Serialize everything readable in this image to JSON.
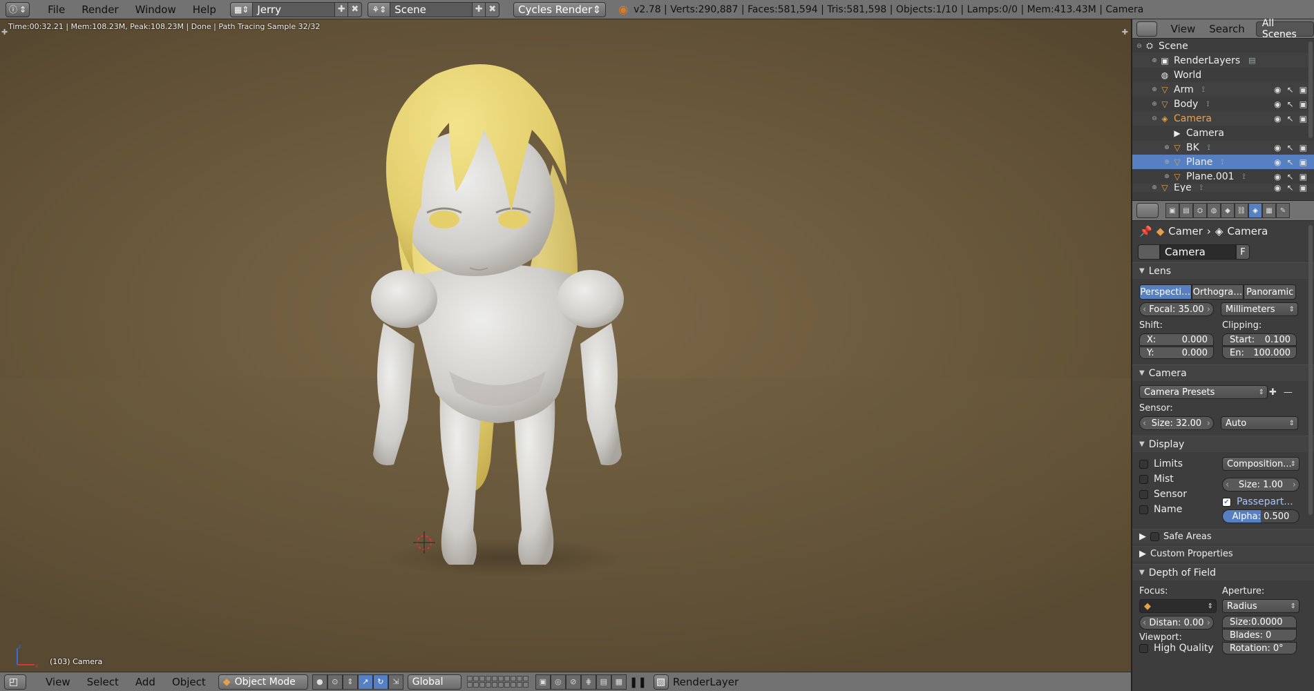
{
  "topbar": {
    "menus": [
      "File",
      "Render",
      "Window",
      "Help"
    ],
    "screen_layout": "Jerry",
    "scene": "Scene",
    "render_engine": "Cycles Render",
    "stats": "v2.78 | Verts:290,887 | Faces:581,594 | Tris:581,598 | Objects:1/10 | Lamps:0/0 | Mem:413.43M | Camera"
  },
  "viewport": {
    "render_stamp": "Time:00:32.21 | Mem:108.23M, Peak:108.23M | Done | Path Tracing Sample 32/32",
    "view_name": "(103) Camera",
    "colors": {
      "hair": "#e9d77a",
      "body": "#d7d5d1",
      "eyes": "#e5cf6a"
    }
  },
  "bottombar": {
    "menus": [
      "View",
      "Select",
      "Add",
      "Object"
    ],
    "mode": "Object Mode",
    "orientation": "Global",
    "render_layer": "RenderLayer"
  },
  "outliner": {
    "header_menus": [
      "View",
      "Search"
    ],
    "filter": "All Scenes",
    "items": [
      {
        "label": "Scene",
        "icon": "scene-icon",
        "indent": 0
      },
      {
        "label": "RenderLayers",
        "icon": "renderlayers-icon",
        "indent": 1
      },
      {
        "label": "World",
        "icon": "world-icon",
        "indent": 1
      },
      {
        "label": "Arm",
        "icon": "mesh-icon",
        "indent": 1
      },
      {
        "label": "Body",
        "icon": "mesh-icon",
        "indent": 1
      },
      {
        "label": "Camera",
        "icon": "camera-object-icon",
        "indent": 1
      },
      {
        "label": "Camera",
        "icon": "camera-data-icon",
        "indent": 2
      },
      {
        "label": "BK",
        "icon": "mesh-icon",
        "indent": 2
      },
      {
        "label": "Plane",
        "icon": "mesh-icon",
        "indent": 2
      },
      {
        "label": "Plane.001",
        "icon": "mesh-icon",
        "indent": 2
      },
      {
        "label": "Eye",
        "icon": "mesh-icon",
        "indent": 1
      }
    ]
  },
  "properties": {
    "breadcrumb": [
      "Camer",
      "Camera"
    ],
    "datablock_name": "Camera",
    "fake_user": "F",
    "lens": {
      "title": "Lens",
      "types": [
        "Perspecti…",
        "Orthogra…",
        "Panoramic"
      ],
      "focal": "Focal: 35.00",
      "unit": "Millimeters",
      "shift_label": "Shift:",
      "clipping_label": "Clipping:",
      "shift_x": "0.000",
      "shift_y": "0.000",
      "clip_start": "0.100",
      "clip_end": "100.000"
    },
    "camera": {
      "title": "Camera",
      "presets": "Camera Presets",
      "sensor_label": "Sensor:",
      "size": "Size:  32.00",
      "fit": "Auto"
    },
    "display": {
      "title": "Display",
      "checks": [
        "Limits",
        "Mist",
        "Sensor",
        "Name"
      ],
      "composition": "Composition...",
      "size": "Size:    1.00",
      "passepartout": "Passepart...",
      "alpha": "Alpha: 0.500"
    },
    "collapsed": [
      "Safe Areas",
      "Custom Properties"
    ],
    "dof": {
      "title": "Depth of Field",
      "focus_label": "Focus:",
      "aperture_label": "Aperture:",
      "aperture_type": "Radius",
      "distance": "Distan: 0.00",
      "size": "Size:0.0000",
      "viewport_label": "Viewport:",
      "blades": "Blades:   0",
      "high_quality": "High Quality",
      "rotation": "Rotation: 0°"
    }
  }
}
